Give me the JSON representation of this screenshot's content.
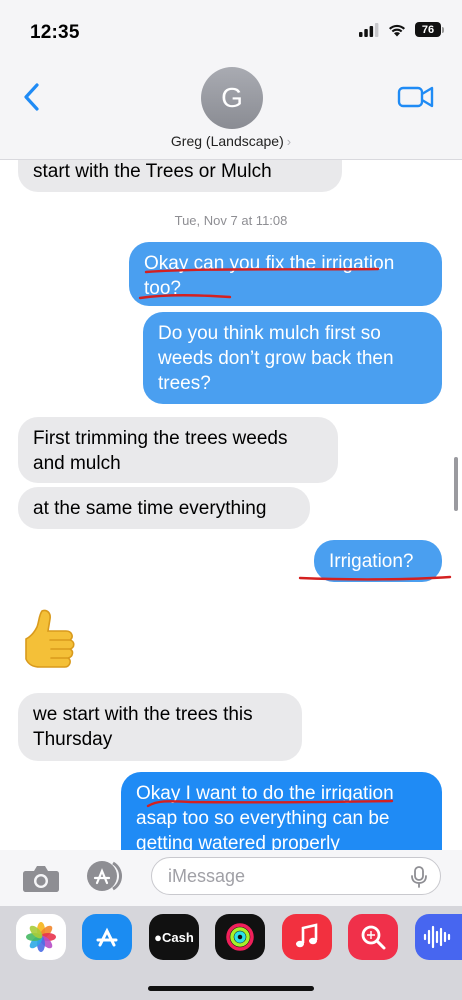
{
  "status_bar": {
    "time": "12:35",
    "battery": "76"
  },
  "header": {
    "avatar_initial": "G",
    "contact_name": "Greg (Landscape)",
    "chevron": "›"
  },
  "thread": {
    "timestamp_day": "Tue, Nov 7",
    "timestamp_time": "at 11:08",
    "messages": [
      {
        "from": "them",
        "text": "start with the Trees or Mulch"
      },
      {
        "from": "me",
        "line1": "Okay can you fix the irrigation",
        "line2": "too?"
      },
      {
        "from": "me",
        "line1": "Do you think mulch first so",
        "line2": "weeds don’t grow back then",
        "line3": "trees?"
      },
      {
        "from": "them",
        "line1": "First trimming the trees weeds",
        "line2": "and mulch"
      },
      {
        "from": "them",
        "text": "at the same time everything"
      },
      {
        "from": "me",
        "text": "Irrigation?"
      },
      {
        "from": "them",
        "emoji": "thumbs-up"
      },
      {
        "from": "them",
        "line1": "we start with the trees this",
        "line2": "Thursday"
      },
      {
        "from": "me",
        "line1": "Okay I want to do the irrigation",
        "line2": "asap too so everything can be",
        "line3": "getting watered properly"
      }
    ]
  },
  "input_bar": {
    "placeholder": "iMessage"
  },
  "app_strip": {
    "apps": [
      "photos-icon",
      "app-store-icon",
      "cash-icon",
      "fitness-icon",
      "music-icon",
      "search-icon",
      "audio-icon"
    ],
    "cash_label": "Cash"
  },
  "colors": {
    "sent_bubble": "#1f8bf5",
    "received_bubble": "#e9e9eb",
    "annotation": "#d42020"
  }
}
